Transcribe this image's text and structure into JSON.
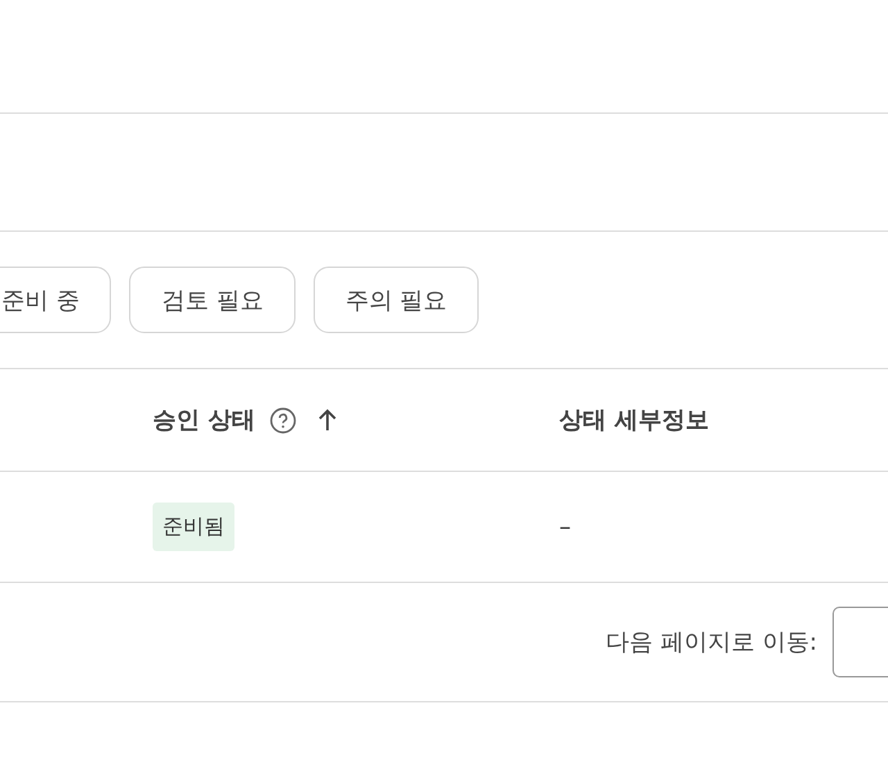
{
  "filter_chips": [
    {
      "label": "준비 중"
    },
    {
      "label": "검토 필요"
    },
    {
      "label": "주의 필요"
    }
  ],
  "table": {
    "columns": [
      {
        "label": "승인 상태",
        "help": true,
        "sorted": true
      },
      {
        "label": "상태 세부정보",
        "help": false,
        "sorted": false
      }
    ],
    "rows": [
      {
        "status": "준비됨",
        "color": "#e6f4ea",
        "details": "–"
      }
    ]
  },
  "pagination": {
    "label": "다음 페이지로 이동:"
  }
}
